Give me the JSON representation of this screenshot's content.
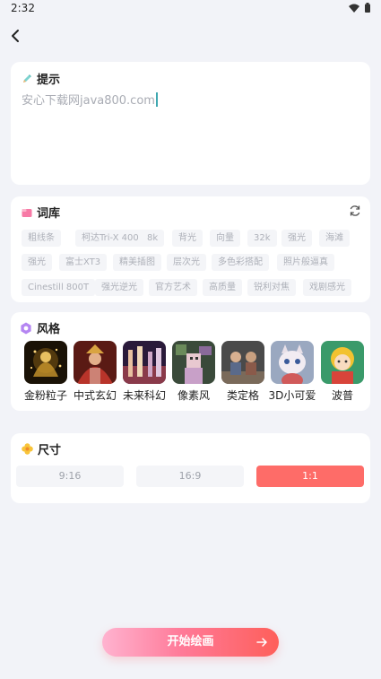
{
  "status_bar": {
    "time": "2:32"
  },
  "prompt": {
    "title": "提示",
    "text": "安心下载网java800.com"
  },
  "lexicon": {
    "title": "词库",
    "tags": [
      [
        "粗线条",
        "柯达Tri-X 400",
        "8k",
        "背光",
        "向量",
        "32k",
        "强光",
        "海滩"
      ],
      [
        "强光",
        "富士XT3",
        "精美插图",
        "层次光",
        "多色彩搭配",
        "照片般逼真"
      ],
      [
        "Cinestill 800T",
        "强光逆光",
        "官方艺术",
        "高质量",
        "锐利对焦",
        "戏剧感光"
      ]
    ]
  },
  "styles": {
    "title": "风格",
    "items": [
      {
        "label": "金粉粒子"
      },
      {
        "label": "中式玄幻"
      },
      {
        "label": "未来科幻"
      },
      {
        "label": "像素风"
      },
      {
        "label": "类定格"
      },
      {
        "label": "3D小可爱"
      },
      {
        "label": "波普"
      }
    ]
  },
  "size": {
    "title": "尺寸",
    "options": [
      "9:16",
      "16:9",
      "1:1"
    ],
    "selected": "1:1",
    "accent": "#fe6c68"
  },
  "start_button": {
    "label": "开始绘画"
  }
}
